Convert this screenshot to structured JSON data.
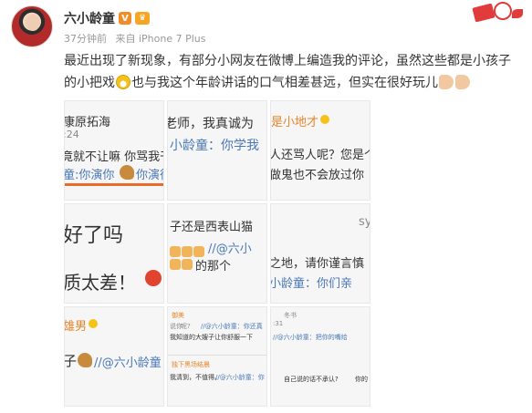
{
  "post": {
    "username": "六小龄童",
    "vip_badge": "V",
    "level_badge": "♛",
    "time": "37分钟前",
    "source": "来自 iPhone 7 Plus",
    "text_part1": "最近出现了新现象，有部分小网友在微博上编造我的评论，虽然这些都是小孩子的小把戏",
    "text_part2": "也与我这个年龄讲话的口气相差甚远，但实在很好玩儿"
  },
  "images": [
    {
      "lines": [
        "康原拓海",
        ":24",
        "竟就不让嘛 你骂我干",
        "童:你演你",
        "你演很"
      ]
    },
    {
      "lines": [
        "老师，我真诚为",
        "小龄童：你学我"
      ]
    },
    {
      "lines": [
        "是小地才",
        "人还骂人呢？您是个",
        "做鬼也不会放过你"
      ]
    },
    {
      "lines": [
        "好了吗",
        "质太差！"
      ]
    },
    {
      "lines": [
        "子还是西表山猫",
        "//@六小",
        "的那个"
      ]
    },
    {
      "lines": [
        "sy",
        "之地，请你谨言慎",
        "小龄童：你们亲"
      ]
    },
    {
      "lines": [
        "雄男",
        "子",
        "//@六小龄童"
      ]
    },
    {
      "lines": [
        "御美",
        "说你",
        "呢?",
        "//@六小龄童：你还真",
        "我知道的大嫂子让你舒服一下",
        "独下黑场结晨",
        "我清到，不值得。",
        "//@六小龄童：你"
      ]
    },
    {
      "lines": [
        "冬书",
        ":31",
        "//@六小龄童：把你的嘴给",
        "自己说的话不承认?",
        "你的"
      ]
    }
  ],
  "icons": {
    "avatar": "avatar",
    "vip": "verified-icon",
    "crown": "crown-icon",
    "laugh": "laugh-emoji-icon",
    "hand": "hand-emoji-icon",
    "deco": "decoration-icon"
  },
  "colors": {
    "accent_blue": "#4a78b8",
    "accent_orange": "#e8852a",
    "vip_orange": "#f28c28"
  }
}
